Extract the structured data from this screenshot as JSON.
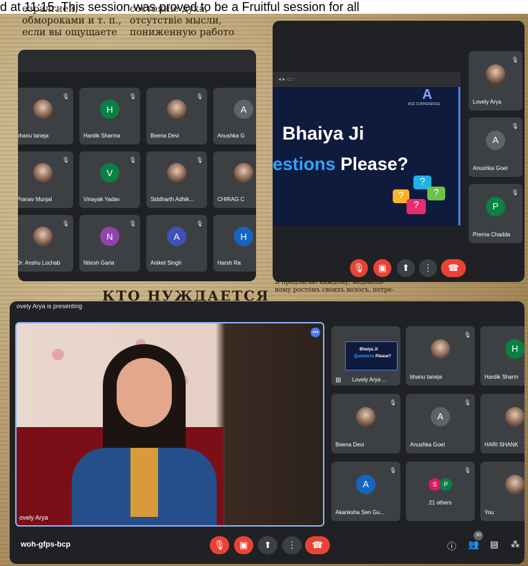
{
  "caption": "d at 11:15. This session was proved to be a Fruitful session for all",
  "newspaper": {
    "col_a": "езралгией,\nобмороками и т. п.,\nесли вы ощущаете",
    "col_b": "состояніе духа,\nотсутствіе мысли,\nпониженную работо",
    "headline": "КТО НУЖДАЕТСЯ",
    "col_c": "Я предлагаю каждому, недоволь-\nному ростомъ своихъ волосъ, потре-"
  },
  "left_panel": {
    "tiles": [
      {
        "name": "bhanu taneja",
        "type": "photo"
      },
      {
        "name": "Hardik Sharma",
        "type": "letter",
        "letter": "H",
        "color": "#0b8043"
      },
      {
        "name": "Beena Devi",
        "type": "photo"
      },
      {
        "name": "Anushka G",
        "type": "letter",
        "letter": "A",
        "color": "#5f6368"
      },
      {
        "name": "Pranav Munjal",
        "type": "photo"
      },
      {
        "name": "Vinayak Yadav",
        "type": "letter",
        "letter": "V",
        "color": "#0b8043"
      },
      {
        "name": "Siddharth Adhik...",
        "type": "photo"
      },
      {
        "name": "CHIRAG C",
        "type": "photo"
      },
      {
        "name": "Dr. Anshu Lochab",
        "type": "photo"
      },
      {
        "name": "Nitesh Garla",
        "type": "letter",
        "letter": "N",
        "color": "#8e44ad"
      },
      {
        "name": "Aniket Singh",
        "type": "letter",
        "letter": "A",
        "color": "#3f51b5"
      },
      {
        "name": "Harsh Ra",
        "type": "letter",
        "letter": "H",
        "color": "#1565c0"
      }
    ]
  },
  "right_panel": {
    "slide": {
      "brand": "ACE CONFERENCE",
      "line1": "Bhaiya Ji",
      "line2a": "estions",
      "line2b": "Please?"
    },
    "side_tiles": [
      {
        "name": "Lovely Arya",
        "type": "photo"
      },
      {
        "name": "Anushka Goel",
        "type": "letter",
        "letter": "A",
        "color": "#5f6368"
      },
      {
        "name": "Prerna Chadda",
        "type": "letter",
        "letter": "P",
        "color": "#0b8043"
      }
    ]
  },
  "bottom_panel": {
    "presenting": "ovely Arya is presenting",
    "speaker_name": "ovely Arya",
    "meeting_code": "woh-gfps-bcp",
    "people_count": "30",
    "thumb_label": "Lovely Arya ...",
    "thumb_slide": {
      "line1": "Bhaiya Ji",
      "line2a": "Questions",
      "line2b": "Please?"
    },
    "tiles": [
      {
        "name": "bhanu taneja",
        "type": "photo"
      },
      {
        "name": "Hardik Sharm",
        "type": "letter",
        "letter": "H",
        "color": "#0b8043"
      },
      {
        "name": "Beena Devi",
        "type": "photo"
      },
      {
        "name": "Anushka Goel",
        "type": "letter",
        "letter": "A",
        "color": "#5f6368"
      },
      {
        "name": "HARI SHANK",
        "type": "photo"
      },
      {
        "name": "Akanksha Sen Gu...",
        "type": "letter",
        "letter": "A",
        "color": "#1565c0"
      },
      {
        "name": "21 others",
        "type": "others",
        "letters": [
          "S",
          "P"
        ]
      },
      {
        "name": "You",
        "type": "photo"
      }
    ]
  }
}
